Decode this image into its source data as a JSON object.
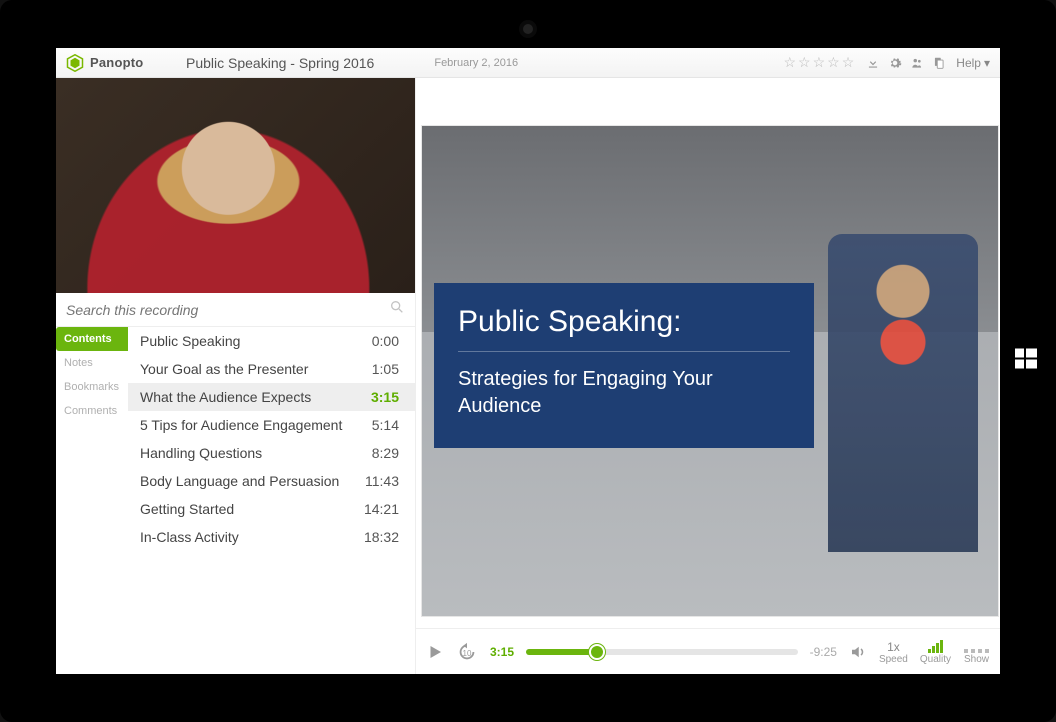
{
  "brand": "Panopto",
  "header": {
    "title": "Public Speaking - Spring 2016",
    "date": "February 2, 2016",
    "help_label": "Help",
    "rating_stars": 5
  },
  "search": {
    "placeholder": "Search this recording"
  },
  "tabs": [
    "Contents",
    "Notes",
    "Bookmarks",
    "Comments"
  ],
  "active_tab": 0,
  "toc": [
    {
      "title": "Public Speaking",
      "time": "0:00",
      "active": false
    },
    {
      "title": "Your Goal as the Presenter",
      "time": "1:05",
      "active": false
    },
    {
      "title": "What the Audience Expects",
      "time": "3:15",
      "active": true
    },
    {
      "title": "5 Tips for Audience Engagement",
      "time": "5:14",
      "active": false
    },
    {
      "title": "Handling Questions",
      "time": "8:29",
      "active": false
    },
    {
      "title": "Body Language and Persuasion",
      "time": "11:43",
      "active": false
    },
    {
      "title": "Getting Started",
      "time": "14:21",
      "active": false
    },
    {
      "title": "In-Class Activity",
      "time": "18:32",
      "active": false
    }
  ],
  "slide": {
    "title": "Public Speaking:",
    "subtitle": "Strategies for Engaging Your Audience"
  },
  "player": {
    "current": "3:15",
    "remaining": "-9:25",
    "progress_pct": 26,
    "speed_label": "1x",
    "speed_caption": "Speed",
    "quality_caption": "Quality",
    "show_caption": "Show",
    "rewind_seconds": "10"
  },
  "colors": {
    "accent": "#6bb50e",
    "slide_panel": "#1e3e73"
  }
}
